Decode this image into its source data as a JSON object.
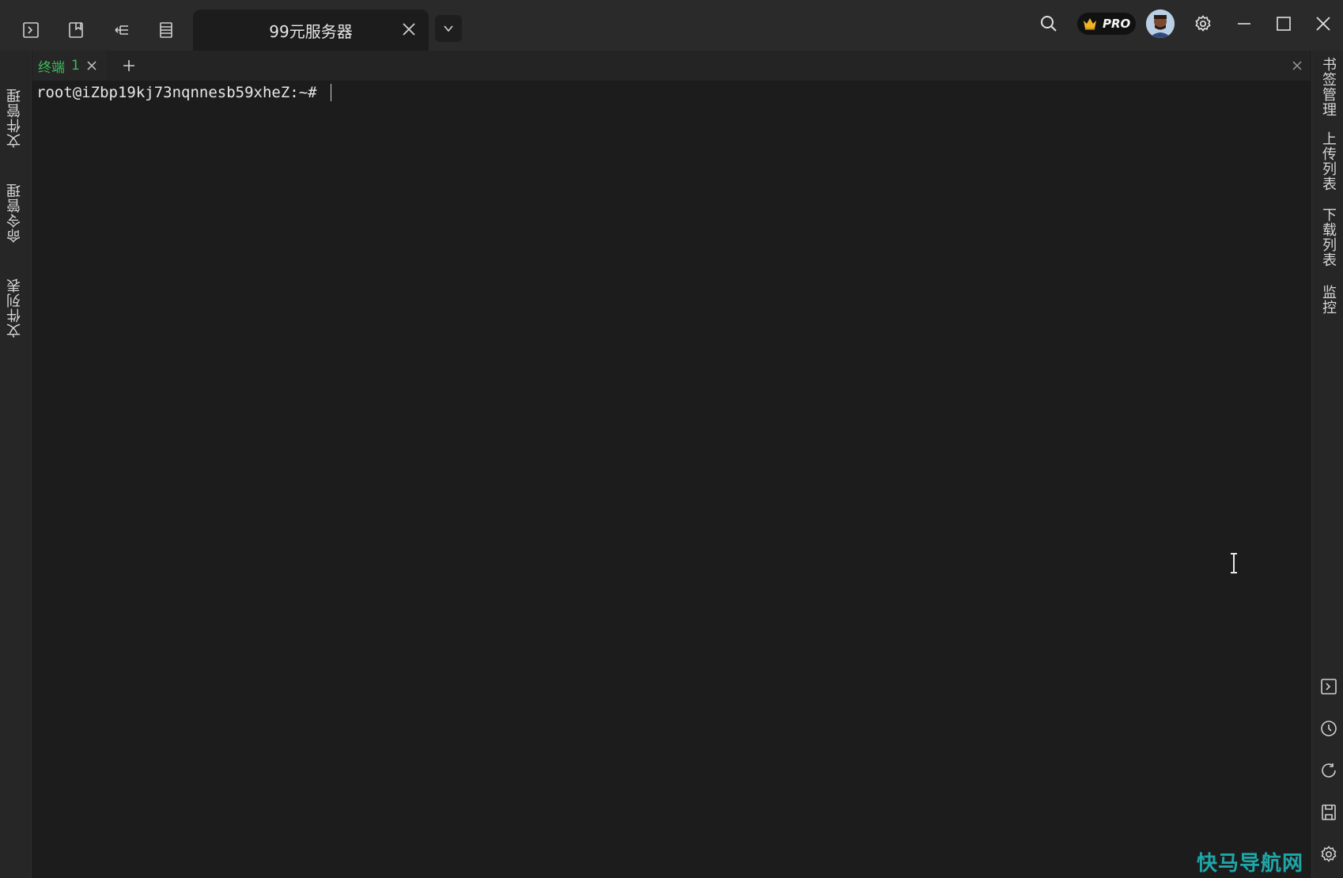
{
  "window": {
    "session_tab_title": "99元服务器",
    "pro_badge": "PRO"
  },
  "left_sidebar": {
    "items": [
      "文件管理",
      "命令管理",
      "文件列表"
    ]
  },
  "right_sidebar": {
    "items": [
      "书签管理",
      "上传列表",
      "下载列表",
      "监控"
    ]
  },
  "terminal_tabs": [
    {
      "name": "终端",
      "index": "1",
      "active": true
    }
  ],
  "terminal": {
    "prompt": "root@iZbp19kj73nqnnesb59xheZ:~# "
  },
  "watermark": "快马导航网",
  "colors": {
    "accent_green": "#3dbb5a",
    "titlebar_bg": "#2a2a2a",
    "terminal_bg": "#1c1c1c",
    "watermark": "#1fa6a8"
  },
  "icons": {
    "titlebar_left": [
      "terminal-icon",
      "bookmark-icon",
      "tree-icon",
      "server-list-icon"
    ],
    "titlebar_right": [
      "search-icon",
      "crown-icon",
      "avatar",
      "gear-icon",
      "minimize-icon",
      "maximize-icon",
      "close-icon"
    ],
    "right_rail_bottom": [
      "terminal-icon",
      "history-icon",
      "refresh-icon",
      "save-icon",
      "gear-icon"
    ]
  }
}
